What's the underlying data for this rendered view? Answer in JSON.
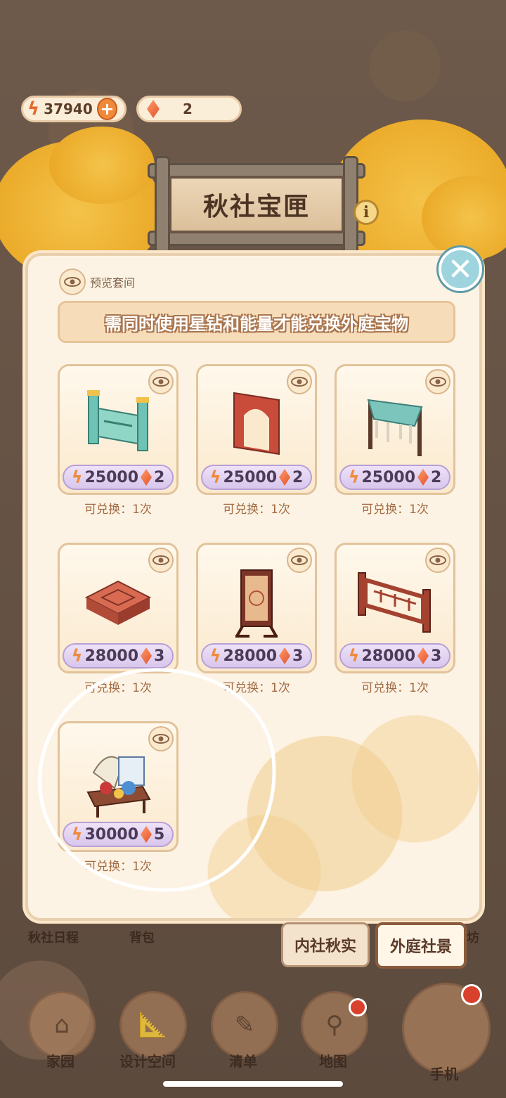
{
  "currency": {
    "energy_value": "37940",
    "gem_value": "2"
  },
  "title": "秋社宝匣",
  "preview_label": "预览套间",
  "notice": "需同时使用星钻和能量才能兑换外庭宝物",
  "items": [
    {
      "energy": "25000",
      "gems": "2",
      "limit": "可兑换：1次",
      "icon": "jade-railing-icon"
    },
    {
      "energy": "25000",
      "gems": "2",
      "limit": "可兑换：1次",
      "icon": "red-arch-doorway-icon"
    },
    {
      "energy": "25000",
      "gems": "2",
      "limit": "可兑换：1次",
      "icon": "teal-canopy-icon"
    },
    {
      "energy": "28000",
      "gems": "3",
      "limit": "可兑换：1次",
      "icon": "square-cushion-icon"
    },
    {
      "energy": "28000",
      "gems": "3",
      "limit": "可兑换：1次",
      "icon": "folding-screen-icon"
    },
    {
      "energy": "28000",
      "gems": "3",
      "limit": "可兑换：1次",
      "icon": "wooden-fence-icon"
    },
    {
      "energy": "30000",
      "gems": "5",
      "limit": "可兑换：1次",
      "icon": "decorated-table-set-icon"
    }
  ],
  "tabs": {
    "inner": "内社秋实",
    "outer": "外庭社景"
  },
  "under_labels": {
    "schedule": "秋社日程",
    "bag": "背包",
    "partial": "坊"
  },
  "nav": {
    "home": "家园",
    "design": "设计空间",
    "list": "清单",
    "map": "地图",
    "phone": "手机"
  },
  "colors": {
    "panel_bg": "#fdf3e4",
    "price_bg": "#d8c6ec",
    "accent_orange": "#f08a3b",
    "close_teal": "#9ed4de"
  }
}
